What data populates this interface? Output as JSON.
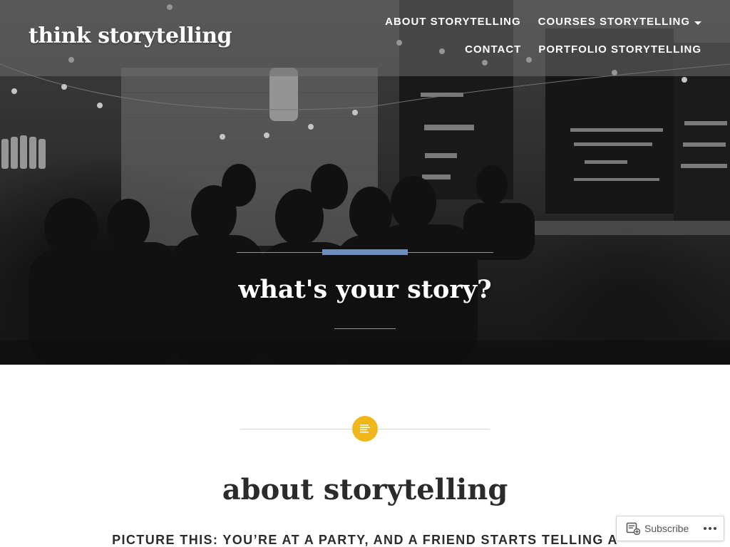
{
  "site": {
    "title": "think storytelling"
  },
  "nav": {
    "items": [
      {
        "label": "ABOUT STORYTELLING",
        "has_submenu": false
      },
      {
        "label": "COURSES STORYTELLING",
        "has_submenu": true
      },
      {
        "label": "CONTACT",
        "has_submenu": false
      },
      {
        "label": "PORTFOLIO STORYTELLING",
        "has_submenu": false
      }
    ]
  },
  "hero": {
    "heading": "what's your story?",
    "accent_color": "#6d8fbf"
  },
  "post": {
    "format_icon": "text-lines-icon",
    "badge_color": "#efb71c",
    "title": "about storytelling",
    "intro": "PICTURE THIS: YOU’RE AT A PARTY, AND A FRIEND STARTS TELLING A"
  },
  "subscribe": {
    "label": "Subscribe",
    "icon": "follow-icon",
    "more_icon": "ellipsis-icon"
  }
}
